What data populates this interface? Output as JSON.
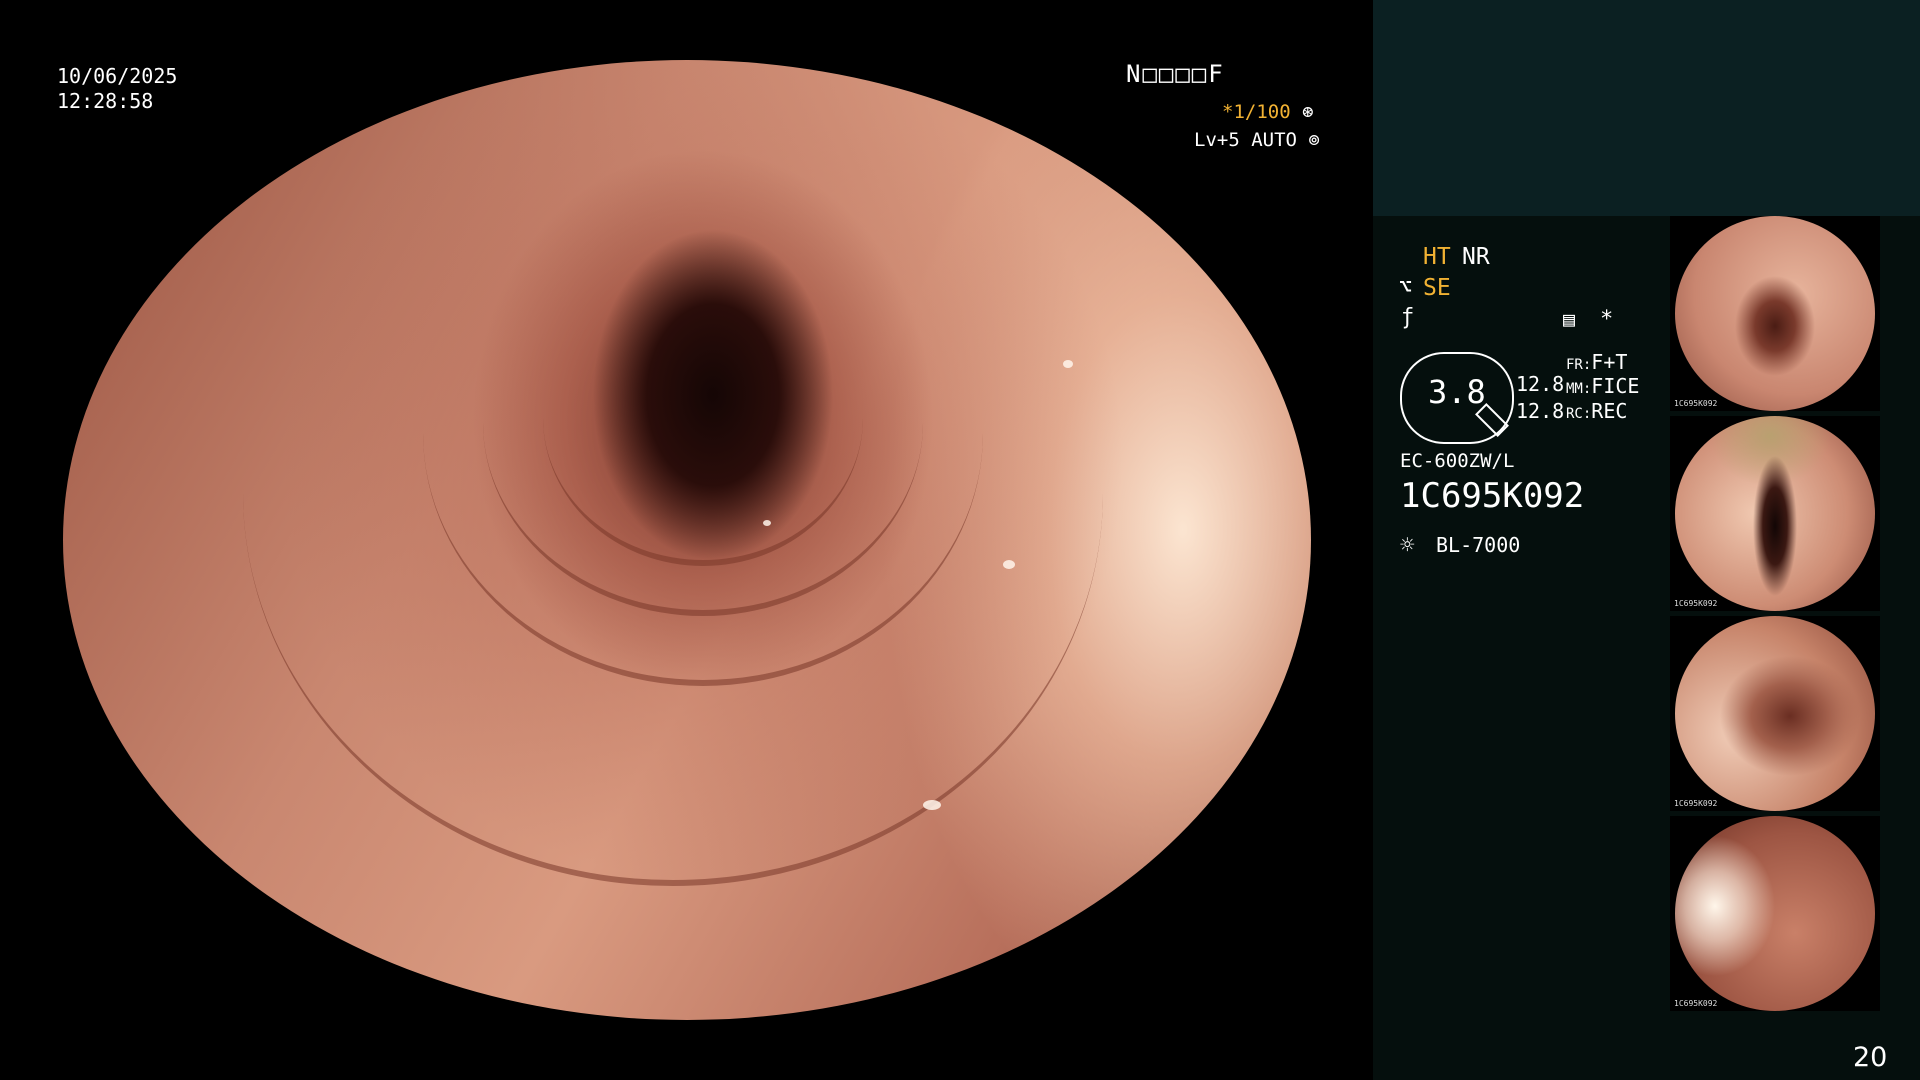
{
  "overlay": {
    "date": "10/06/2025",
    "time": "12:28:58",
    "patient_code": "N□□□□F",
    "exposure": "*1/100",
    "exposure_icon": "shutter-icon",
    "level": "Lv+5 AUTO",
    "level_icon": "iris-icon"
  },
  "panel": {
    "ht": "HT",
    "nr": "NR",
    "se": "SE",
    "se_icon": "enhance-icon",
    "f_icon": "freeze-icon",
    "memo_icon": "memo-icon",
    "star": "*",
    "scope_dia": "3.8",
    "zoom_top": "12.8",
    "zoom_bottom": "12.8",
    "fr_label": "FR:",
    "fr_value": "F+T",
    "mm_label": "MM:",
    "mm_value": "FICE",
    "rc_label": "RC:",
    "rc_value": "REC",
    "model": "EC-600ZW/L",
    "serial": "1C695K092",
    "light_icon": "light-source-icon",
    "light": "BL-7000",
    "page_number": "20"
  },
  "thumbnails": [
    {
      "label": "1C695K092"
    },
    {
      "label": "1C695K092"
    },
    {
      "label": "1C695K092"
    },
    {
      "label": "1C695K092"
    }
  ],
  "colors": {
    "accent": "#f2b233",
    "panel_bg": "#050f0d",
    "panel_top_bg": "#0b2022"
  }
}
